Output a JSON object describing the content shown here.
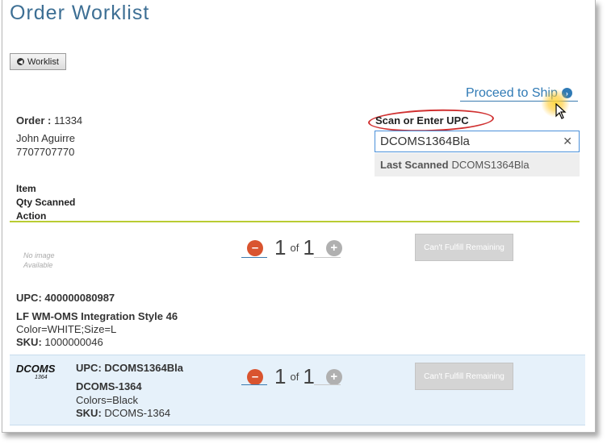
{
  "page": {
    "title": "Order Worklist"
  },
  "nav": {
    "back_label": "Worklist",
    "proceed_label": "Proceed to Ship"
  },
  "order": {
    "label": "Order :",
    "number": "11334",
    "customer_name": "John Aguirre",
    "phone": "7707707770"
  },
  "scan": {
    "label": "Scan or Enter UPC",
    "value": "DCOMS1364Bla",
    "clear_symbol": "✕",
    "last_scanned_label": "Last Scanned",
    "last_scanned_value": "DCOMS1364Bla"
  },
  "columns": {
    "item": "Item",
    "qty_scanned": "Qty Scanned",
    "action": "Action"
  },
  "items": [
    {
      "image_text": [
        "No image",
        "Available"
      ],
      "upc_label": "UPC:",
      "upc": "400000080987",
      "name": "LF WM-OMS Integration Style 46",
      "attributes": "Color=WHITE;Size=L",
      "sku_label": "SKU:",
      "sku": "1000000046",
      "qty_scanned": "1",
      "qty_of": "of",
      "qty_total": "1",
      "action_label": "Can't Fulfill Remaining"
    },
    {
      "logo_text": "DCOMS",
      "logo_subtext": "1364",
      "upc_label": "UPC:",
      "upc": "DCOMS1364Bla",
      "name": "DCOMS-1364",
      "attributes": "Colors=Black",
      "sku_label": "SKU:",
      "sku": "DCOMS-1364",
      "qty_scanned": "1",
      "qty_of": "of",
      "qty_total": "1",
      "action_label": "Can't Fulfill Remaining"
    }
  ],
  "icons": {
    "back": "chevron-left-circle-icon",
    "proceed": "chevron-right-circle-icon",
    "minus": "minus-circle-icon",
    "plus": "plus-circle-icon"
  },
  "colors": {
    "title": "#3d6f94",
    "link": "#2f7ab5",
    "accent_line": "#b9cc33",
    "minus": "#d9542f",
    "highlight_row": "#e6f1fa"
  }
}
